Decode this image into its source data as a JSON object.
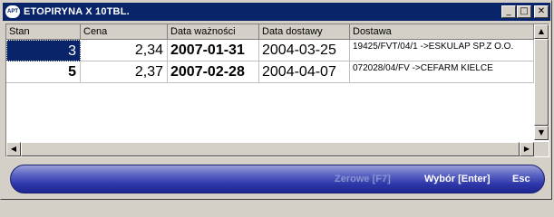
{
  "window": {
    "title": "ETOPIRYNA X 10TBL.",
    "app_icon_text": "APT",
    "controls": {
      "minimize": "_",
      "maximize": "□",
      "close": "✕"
    }
  },
  "table": {
    "columns": [
      "Stan",
      "Cena",
      "Data ważności",
      "Data dostawy",
      "Dostawa"
    ],
    "rows": [
      {
        "stan": "3",
        "cena": "2,34",
        "data_waznosci": "2007-01-31",
        "data_dostawy": "2004-03-25",
        "dostawa": "19425/FVT/04/1 ->ESKULAP SP.Z O.O."
      },
      {
        "stan": "5",
        "cena": "2,37",
        "data_waznosci": "2007-02-28",
        "data_dostawy": "2004-04-07",
        "dostawa": "072028/04/FV ->CEFARM KIELCE"
      }
    ],
    "selected_row": 0
  },
  "actions": {
    "zerowe": "Zerowe [F7]",
    "wybor": "Wybór [Enter]",
    "esc": "Esc"
  },
  "colors": {
    "titlebar": "#0a246a",
    "selection": "#0a246a",
    "bar_gradient_top": "#9aa0d8",
    "bar_gradient_bottom": "#1d2690"
  }
}
